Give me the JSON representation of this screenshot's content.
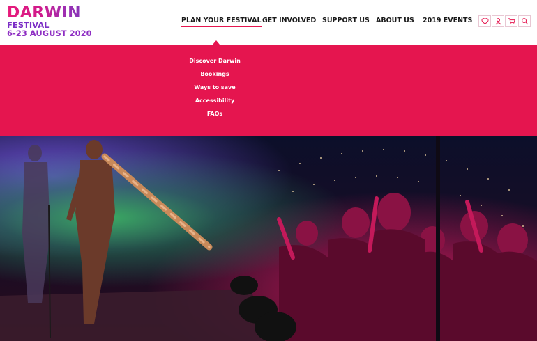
{
  "logo": {
    "word": "DARWIN",
    "sub": "FESTIVAL",
    "dates": "6-23 AUGUST 2020"
  },
  "nav": {
    "items": [
      {
        "label": "PLAN YOUR FESTIVAL",
        "active": true
      },
      {
        "label": "GET INVOLVED"
      },
      {
        "label": "SUPPORT US"
      },
      {
        "label": "ABOUT US"
      },
      {
        "label": "2019 EVENTS"
      }
    ]
  },
  "icons": [
    "heart-icon",
    "user-icon",
    "cart-icon",
    "search-icon"
  ],
  "dropdown": {
    "items": [
      {
        "label": "Discover Darwin",
        "active": true
      },
      {
        "label": "Bookings"
      },
      {
        "label": "Ways to save"
      },
      {
        "label": "Accessibility"
      },
      {
        "label": "FAQs"
      }
    ]
  },
  "colors": {
    "accent": "#e5154f",
    "logo_purple": "#7c2fc6",
    "text": "#1a1a1a"
  }
}
